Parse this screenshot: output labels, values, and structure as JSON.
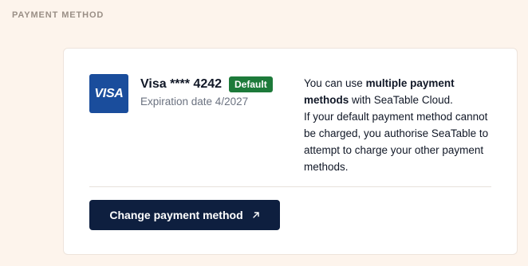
{
  "section": {
    "title": "PAYMENT METHOD"
  },
  "card": {
    "brand_logo_text": "VISA",
    "name": "Visa **** 4242",
    "badge": "Default",
    "expiry": "Expiration date 4/2027"
  },
  "info": {
    "p1_prefix": "You can use ",
    "p1_bold": "multiple payment methods",
    "p1_suffix": " with SeaTable Cloud.",
    "p2": "If your default payment method cannot be charged, you authorise SeaTable to attempt to charge your other payment methods."
  },
  "actions": {
    "change_label": "Change payment method",
    "change_icon": "external-arrow-icon"
  },
  "colors": {
    "page_bg": "#fdf4ec",
    "card_bg": "#ffffff",
    "visa_blue": "#1a4d9c",
    "badge_green": "#1d7a3a",
    "button_navy": "#0e1f3f"
  }
}
